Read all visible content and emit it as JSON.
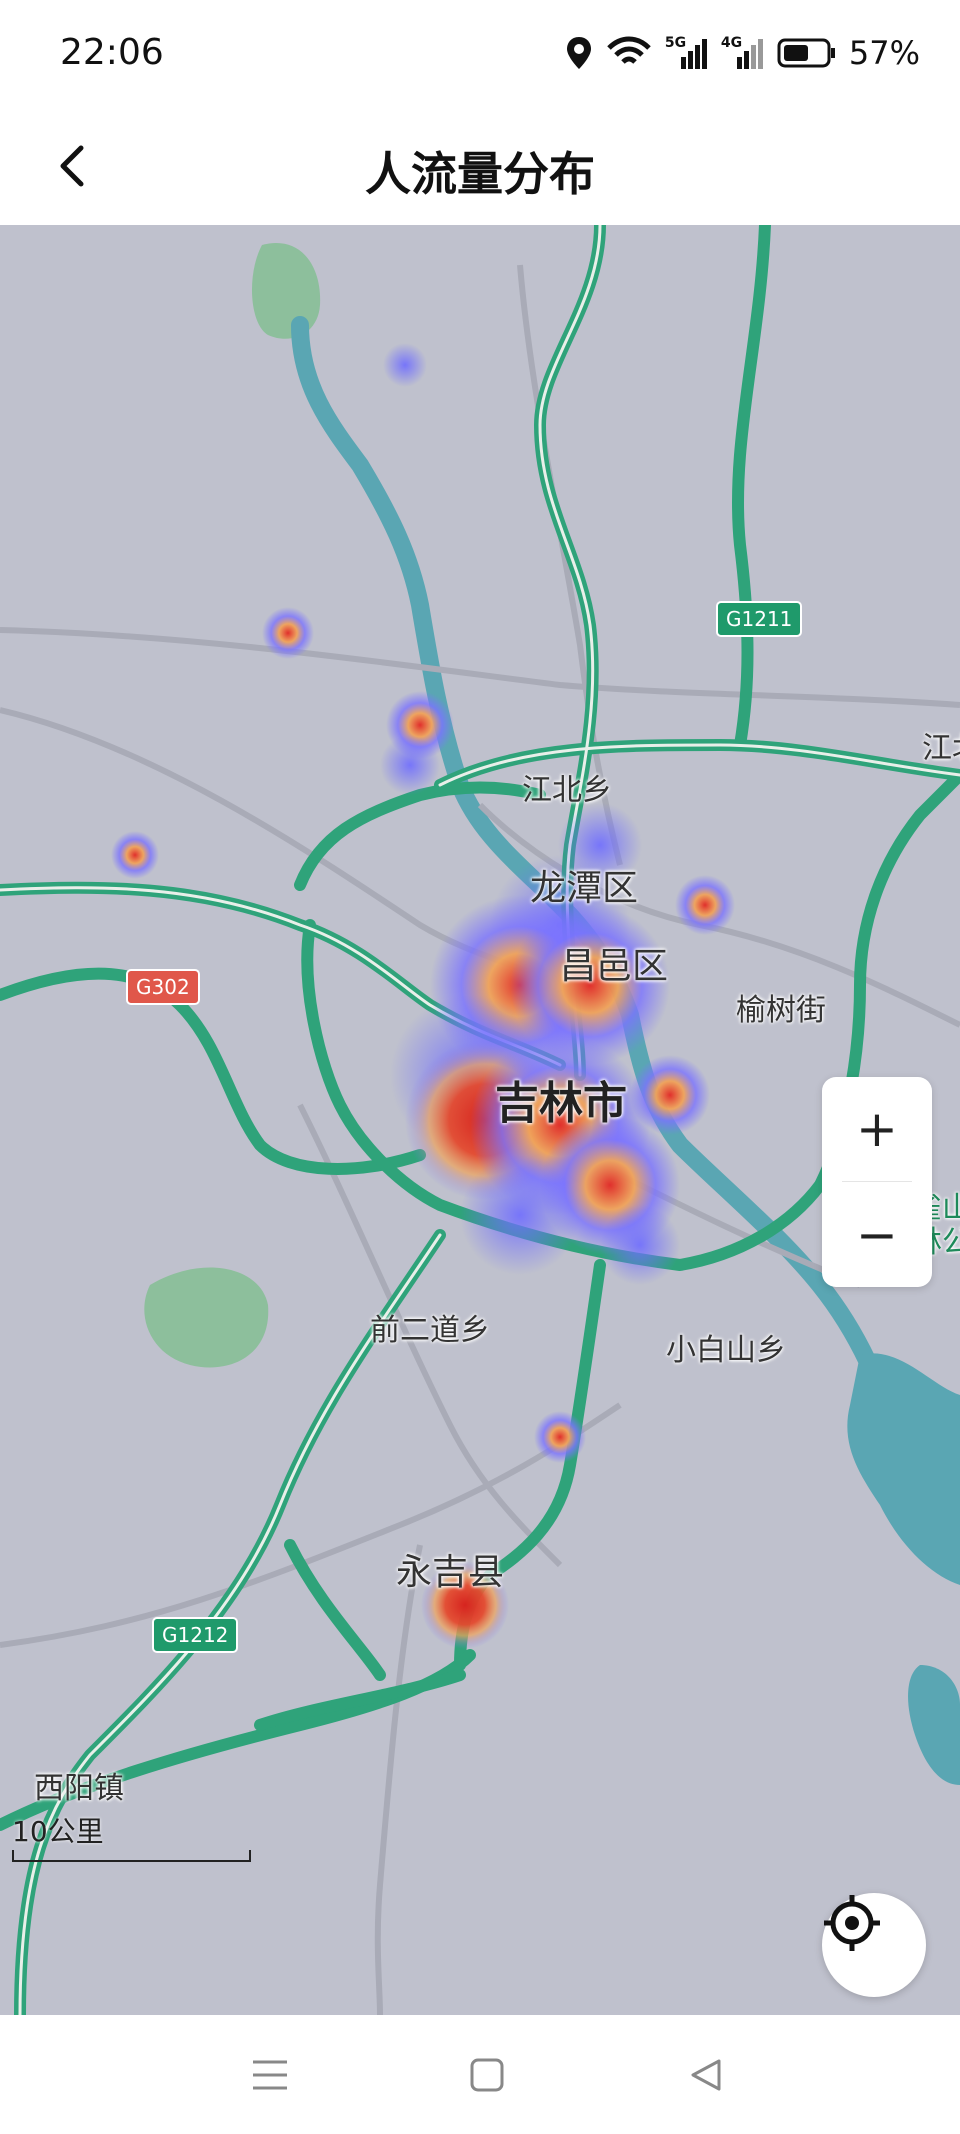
{
  "status_bar": {
    "time": "22:06",
    "network_1": "5G",
    "network_2": "4G",
    "battery_percent": "57%",
    "icons": [
      "location-icon",
      "wifi-icon",
      "signal-5g-icon",
      "signal-4g-icon",
      "battery-icon"
    ]
  },
  "header": {
    "title": "人流量分布",
    "back_icon": "chevron-left-icon"
  },
  "map": {
    "labels": {
      "jiangbei": "江北乡",
      "longtan": "龙潭区",
      "changyi": "昌邑区",
      "jilin": "吉林市",
      "yushu": "榆树街",
      "qianerdao": "前二道乡",
      "xiaobaishan": "小白山乡",
      "yongji": "永吉县",
      "xiyang": "西阳镇",
      "jiang_edge": "江北",
      "zhuque_1": "朱雀山",
      "zhuque_2": "森林公"
    },
    "shields": {
      "g1211": "G1211",
      "g302": "G302",
      "g1212": "G1212"
    },
    "scale_label": "10公里",
    "zoom_in": "+",
    "zoom_out": "−",
    "colors": {
      "background": "#bfc1cd",
      "water": "#5aa6b3",
      "green": "#8dbf9c",
      "expressway": "#2fa37a",
      "heat_low": "#6f6dff",
      "heat_mid": "#f0a35a",
      "heat_high": "#e0302c"
    }
  },
  "system_nav": {
    "icons": [
      "menu-icon",
      "home-square-icon",
      "back-triangle-icon"
    ]
  }
}
